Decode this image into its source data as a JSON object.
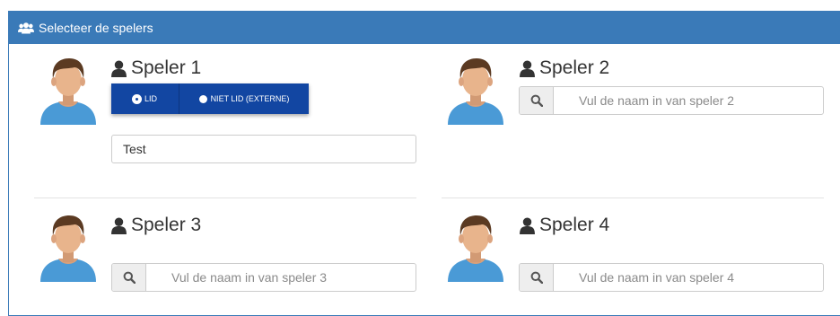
{
  "panel": {
    "title": "Selecteer de spelers"
  },
  "players": [
    {
      "title": "Speler 1",
      "membership": {
        "options": [
          "LID",
          "NIET LID (EXTERNE)"
        ],
        "selected": "LID"
      },
      "input_value": "Test"
    },
    {
      "title": "Speler 2",
      "search_placeholder": "Vul de naam in van speler 2"
    },
    {
      "title": "Speler 3",
      "search_placeholder": "Vul de naam in van speler 3"
    },
    {
      "title": "Speler 4",
      "search_placeholder": "Vul de naam in van speler 4"
    }
  ],
  "icons": {
    "heading": "users-icon",
    "player_title": "user-icon",
    "search": "search-icon",
    "avatar": "avatar-icon"
  },
  "colors": {
    "heading_bg": "#3a7ab8",
    "toggle_bg": "#1246a2",
    "avatar_shirt": "#4a9ad6"
  }
}
